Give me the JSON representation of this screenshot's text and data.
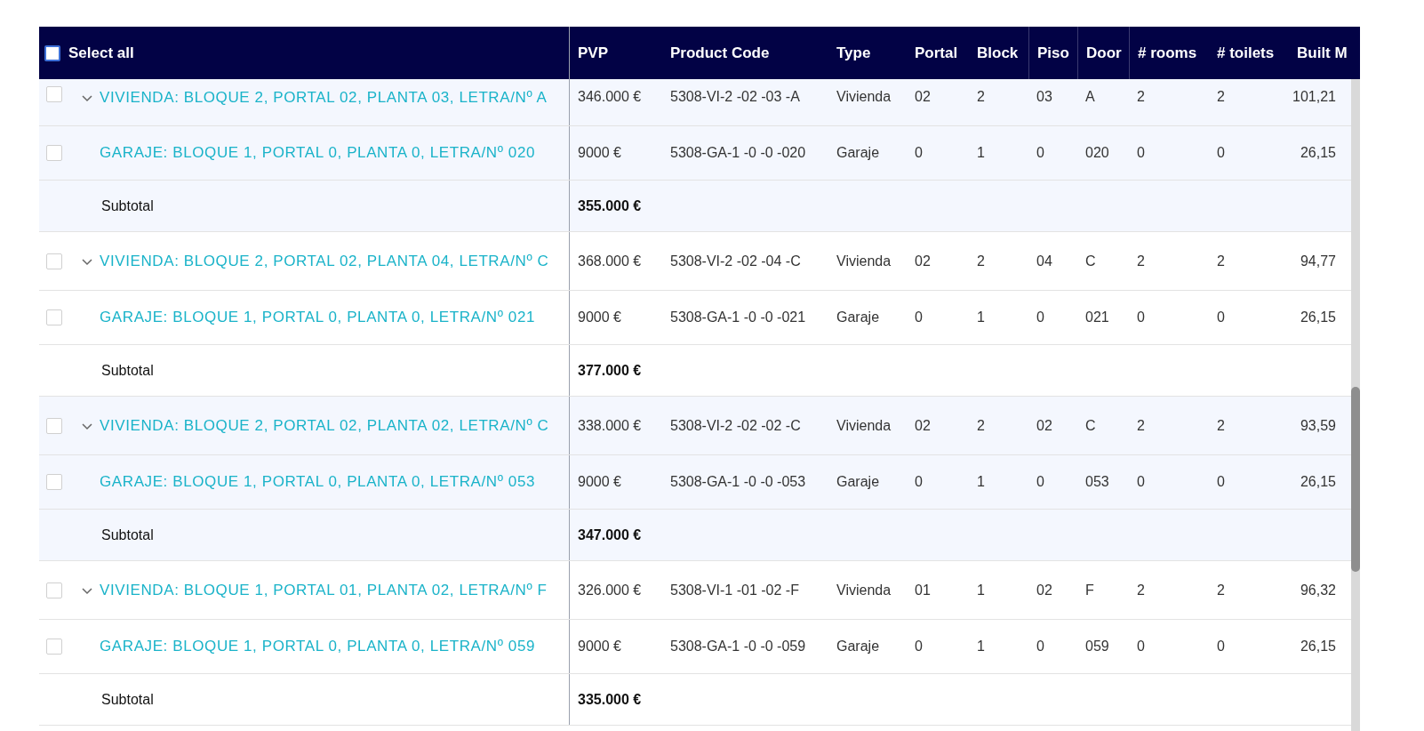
{
  "header": {
    "select_all": {
      "label": "Select all",
      "checked": false
    },
    "columns": [
      "PVP",
      "Product Code",
      "Type",
      "Portal",
      "Block",
      "Piso",
      "Door",
      "# rooms",
      "# toilets",
      "Built M"
    ]
  },
  "groups": [
    {
      "title": "VIVIENDA: BLOQUE 2, PORTAL 02, PLANTA 03, LETRA/Nº A",
      "checked": false,
      "expanded": true,
      "cells": [
        "346.000 €",
        "5308-VI-2 -02 -03 -A",
        "Vivienda",
        "02",
        "2",
        "03",
        "A",
        "2",
        "2",
        "101,21"
      ],
      "children": [
        {
          "title": "GARAJE: BLOQUE 1, PORTAL 0, PLANTA 0, LETRA/Nº 020",
          "checked": false,
          "cells": [
            "9000 €",
            "5308-GA-1 -0 -0 -020",
            "Garaje",
            "0",
            "1",
            "0",
            "020",
            "0",
            "0",
            "26,15"
          ]
        }
      ],
      "subtotal": {
        "label": "Subtotal",
        "value": "355.000 €"
      }
    },
    {
      "title": "VIVIENDA: BLOQUE 2, PORTAL 02, PLANTA 04, LETRA/Nº C",
      "checked": false,
      "expanded": true,
      "cells": [
        "368.000 €",
        "5308-VI-2 -02 -04 -C",
        "Vivienda",
        "02",
        "2",
        "04",
        "C",
        "2",
        "2",
        "94,77"
      ],
      "children": [
        {
          "title": "GARAJE: BLOQUE 1, PORTAL 0, PLANTA 0, LETRA/Nº 021",
          "checked": false,
          "cells": [
            "9000 €",
            "5308-GA-1 -0 -0 -021",
            "Garaje",
            "0",
            "1",
            "0",
            "021",
            "0",
            "0",
            "26,15"
          ]
        }
      ],
      "subtotal": {
        "label": "Subtotal",
        "value": "377.000 €"
      }
    },
    {
      "title": "VIVIENDA: BLOQUE 2, PORTAL 02, PLANTA 02, LETRA/Nº C",
      "checked": false,
      "expanded": true,
      "cells": [
        "338.000 €",
        "5308-VI-2 -02 -02 -C",
        "Vivienda",
        "02",
        "2",
        "02",
        "C",
        "2",
        "2",
        "93,59"
      ],
      "children": [
        {
          "title": "GARAJE: BLOQUE 1, PORTAL 0, PLANTA 0, LETRA/Nº 053",
          "checked": false,
          "cells": [
            "9000 €",
            "5308-GA-1 -0 -0 -053",
            "Garaje",
            "0",
            "1",
            "0",
            "053",
            "0",
            "0",
            "26,15"
          ]
        }
      ],
      "subtotal": {
        "label": "Subtotal",
        "value": "347.000 €"
      }
    },
    {
      "title": "VIVIENDA: BLOQUE 1, PORTAL 01, PLANTA 02, LETRA/Nº F",
      "checked": false,
      "expanded": true,
      "cells": [
        "326.000 €",
        "5308-VI-1 -01 -02 -F",
        "Vivienda",
        "01",
        "1",
        "02",
        "F",
        "2",
        "2",
        "96,32"
      ],
      "children": [
        {
          "title": "GARAJE: BLOQUE 1, PORTAL 0, PLANTA 0, LETRA/Nº 059",
          "checked": false,
          "cells": [
            "9000 €",
            "5308-GA-1 -0 -0 -059",
            "Garaje",
            "0",
            "1",
            "0",
            "059",
            "0",
            "0",
            "26,15"
          ]
        }
      ],
      "subtotal": {
        "label": "Subtotal",
        "value": "335.000 €"
      }
    }
  ]
}
